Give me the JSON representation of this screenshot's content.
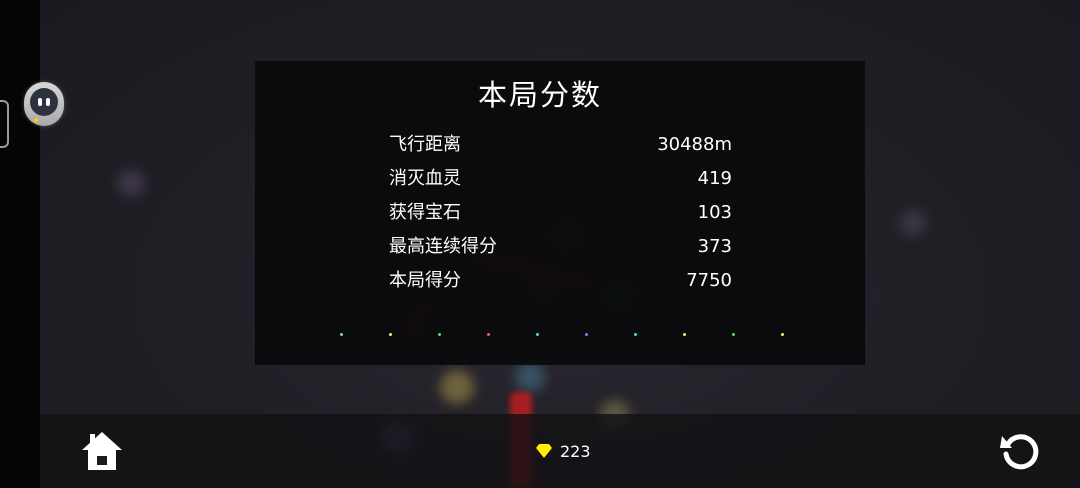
{
  "score_panel": {
    "title": "本局分数",
    "stats": [
      {
        "label": "飞行距离",
        "value": "30488m"
      },
      {
        "label": "消灭血灵",
        "value": "419"
      },
      {
        "label": "获得宝石",
        "value": "103"
      },
      {
        "label": "最高连续得分",
        "value": "373"
      },
      {
        "label": "本局得分",
        "value": "7750"
      }
    ]
  },
  "progress_dots": [
    "#7ad9c0",
    "#f0f060",
    "#63d46a",
    "#ff5b5b",
    "#4fd6d6",
    "#7f7cff",
    "#4fd6d6",
    "#f0f060",
    "#63d46a",
    "#f0f060"
  ],
  "bottom_bar": {
    "gem_count": "223",
    "gem_color": "#ffee00",
    "home_icon": "home-icon",
    "restart_icon": "restart-icon"
  },
  "overlay": {
    "assistant_icon": "assistant-bot-icon"
  }
}
